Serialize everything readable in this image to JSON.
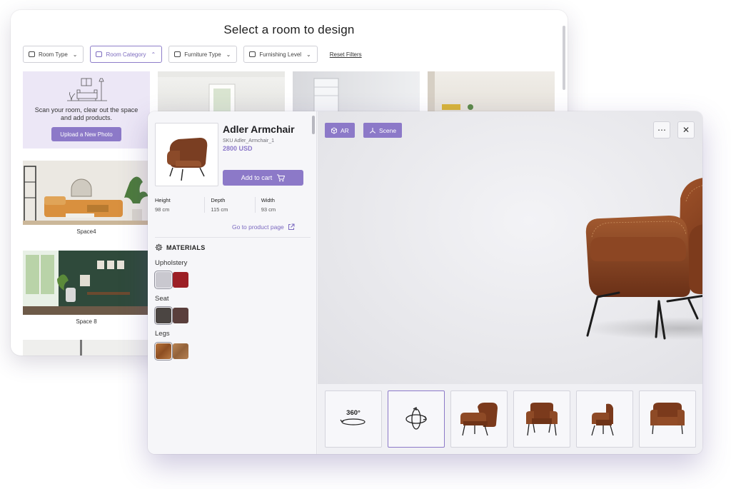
{
  "back_window": {
    "title": "Select a room to design",
    "filters": [
      {
        "label": "Room Type"
      },
      {
        "label": "Room Category"
      },
      {
        "label": "Furniture Type"
      },
      {
        "label": "Furnishing Level"
      }
    ],
    "reset_label": "Reset Filters",
    "upload_text": "Scan your room, clear out the space and add products.",
    "upload_button": "Upload a New Photo",
    "rooms": [
      {
        "label": "Space4"
      },
      {
        "label": "Space 8"
      }
    ]
  },
  "product": {
    "name": "Adler Armchair",
    "sku": "SKU Adler_Armchair_1",
    "price": "2800 USD",
    "add_to_cart": "Add to cart",
    "dimensions": [
      {
        "label": "Height",
        "value": "98 cm"
      },
      {
        "label": "Depth",
        "value": "115 cm"
      },
      {
        "label": "Width",
        "value": "93 cm"
      }
    ],
    "product_link": "Go to product page"
  },
  "materials": {
    "heading": "MATERIALS",
    "groups": [
      {
        "label": "Upholstery",
        "swatches": [
          "#c9c8cf",
          "#9c1f25"
        ],
        "selected": 0
      },
      {
        "label": "Seat",
        "swatches": [
          "#4b4542",
          "#5a3f3c"
        ],
        "selected": 0
      },
      {
        "label": "Legs",
        "swatches": [
          "#a7662f",
          "#a97447"
        ],
        "selected": 0
      }
    ]
  },
  "viewer": {
    "ar_label": "AR",
    "scene_label": "Scene",
    "more_label": "⋯",
    "close_label": "✕"
  },
  "thumbnails": {
    "label_360": "360°"
  }
}
